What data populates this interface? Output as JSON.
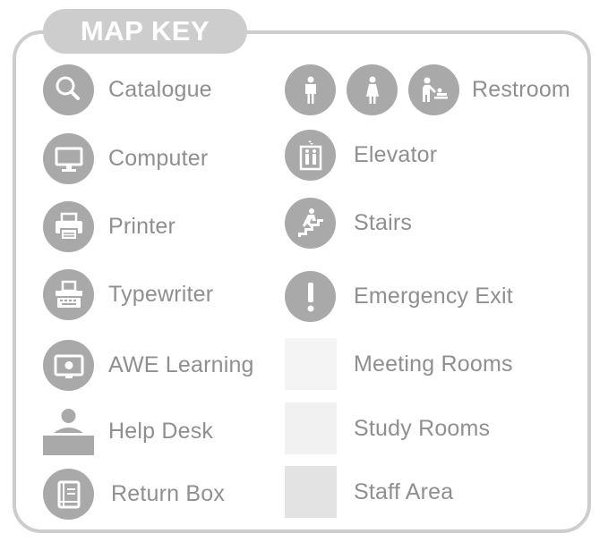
{
  "title": "MAP KEY",
  "left_column": [
    {
      "label": "Catalogue",
      "icon": "search-icon"
    },
    {
      "label": "Computer",
      "icon": "computer-icon"
    },
    {
      "label": "Printer",
      "icon": "printer-icon"
    },
    {
      "label": "Typewriter",
      "icon": "typewriter-icon"
    },
    {
      "label": "AWE Learning",
      "icon": "awe-learning-icon"
    },
    {
      "label": "Help Desk",
      "icon": "help-desk-icon"
    },
    {
      "label": "Return Box",
      "icon": "return-box-icon"
    }
  ],
  "right_column": [
    {
      "label": "Restroom",
      "icons": [
        "mens-restroom-icon",
        "womens-restroom-icon",
        "baby-changing-icon"
      ]
    },
    {
      "label": "Elevator",
      "icon": "elevator-icon"
    },
    {
      "label": "Stairs",
      "icon": "stairs-icon"
    },
    {
      "label": "Emergency Exit",
      "icon": "emergency-exit-icon"
    },
    {
      "label": "Meeting Rooms",
      "swatch_color": "#f4f4f4"
    },
    {
      "label": "Study Rooms",
      "swatch_color": "#f1f1f1"
    },
    {
      "label": "Staff Area",
      "swatch_color": "#e3e3e3"
    }
  ],
  "colors": {
    "frame": "#cdcdcd",
    "icon_fill": "#a9a9a9",
    "text": "#8f8f8f"
  }
}
